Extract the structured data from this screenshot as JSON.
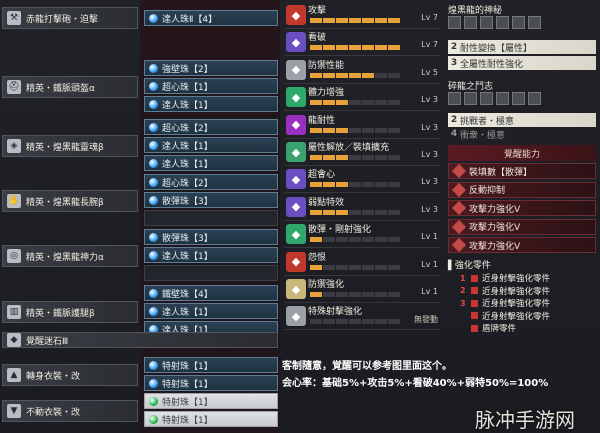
{
  "equipment": [
    {
      "name": "赤龍打擊砲・迫擊",
      "icon": "weapon-icon",
      "decos": [
        "達人珠Ⅱ【4】"
      ]
    },
    {
      "name": "精英・鐵脈頭盔α",
      "icon": "helmet-icon",
      "decos": [
        "強壁珠【2】",
        "超心珠【1】",
        "達人珠【1】"
      ]
    },
    {
      "name": "精英・煌黑龍靈魂β",
      "icon": "chest-icon",
      "decos": [
        "超心珠【2】",
        "達人珠【1】",
        "達人珠【1】"
      ]
    },
    {
      "name": "精英・煌黑龍長腕β",
      "icon": "arm-icon",
      "decos": [
        "超心珠【2】",
        "散彈珠【3】",
        ""
      ]
    },
    {
      "name": "精英・煌黑龍神力α",
      "icon": "waist-icon",
      "decos": [
        "散彈珠【3】",
        "達人珠【1】",
        ""
      ]
    },
    {
      "name": "精英・鐵脈護腿β",
      "icon": "leg-icon",
      "decos": [
        "鐵壁珠【4】",
        "達人珠【1】",
        "達人珠【1】"
      ]
    },
    {
      "name": "覺醒迷石Ⅲ",
      "icon": "charm-icon",
      "decos": []
    },
    {
      "name": "轉身衣裝・改",
      "icon": "mantle-icon",
      "decos": [
        "特射珠【1】",
        "特射珠【1】"
      ]
    },
    {
      "name": "不動衣裝・改",
      "icon": "mantle2-icon",
      "decos": [
        "特射珠【1】",
        "特射珠【1】"
      ]
    }
  ],
  "skills": [
    {
      "name": "攻擊",
      "lv": "Lv 7",
      "color": "#c0392b",
      "icon": "attack-icon",
      "fill": 7
    },
    {
      "name": "看破",
      "lv": "Lv 7",
      "color": "#6b4fc2",
      "icon": "eye-icon",
      "fill": 7
    },
    {
      "name": "防禦性能",
      "lv": "Lv 5",
      "color": "#9aa0a6",
      "icon": "guard-icon",
      "fill": 5
    },
    {
      "name": "體力增強",
      "lv": "Lv 3",
      "color": "#2fa86b",
      "icon": "health-icon",
      "fill": 3
    },
    {
      "name": "龍耐性",
      "lv": "Lv 3",
      "color": "#9b2fc2",
      "icon": "dragon-icon",
      "fill": 3
    },
    {
      "name": "屬性解放／裝填擴充",
      "lv": "Lv 3",
      "color": "#3aa36e",
      "icon": "unlock-icon",
      "fill": 3
    },
    {
      "name": "超會心",
      "lv": "Lv 3",
      "color": "#6b4fc2",
      "icon": "crit-icon",
      "fill": 3
    },
    {
      "name": "弱點特效",
      "lv": "Lv 3",
      "color": "#6b4fc2",
      "icon": "weakness-icon",
      "fill": 3
    },
    {
      "name": "散彈・剛射強化",
      "lv": "Lv 1",
      "color": "#2fa86b",
      "icon": "spread-icon",
      "fill": 1
    },
    {
      "name": "怨恨",
      "lv": "Lv 1",
      "color": "#c0392b",
      "icon": "resent-icon",
      "fill": 1
    },
    {
      "name": "防禦強化",
      "lv": "Lv 1",
      "color": "#c9b77a",
      "icon": "shield-icon",
      "fill": 1
    },
    {
      "name": "特殊射擊強化",
      "lv": "無發動",
      "color": "#9aa0a6",
      "icon": "special-icon",
      "fill": 0
    }
  ],
  "set_bonus_1": {
    "title": "煌黑龍的神秘",
    "items": [
      {
        "num": "2",
        "label": "耐性變換【屬性】"
      },
      {
        "num": "3",
        "label": "全屬性耐性強化"
      }
    ]
  },
  "set_bonus_2": {
    "title": "碎龍之鬥志",
    "items": [
      {
        "num": "2",
        "label": "挑戰者・極意"
      },
      {
        "num": "4",
        "label": "衝衆・極意"
      }
    ]
  },
  "awaken": {
    "title": "覺醒能力",
    "rows": [
      "裝填數【散彈】",
      "反動抑制",
      "攻擊力強化Ⅴ",
      "攻擊力強化Ⅴ",
      "攻擊力強化Ⅴ"
    ]
  },
  "augments": {
    "title": "強化零件",
    "items": [
      {
        "num": "1",
        "label": "近身射擊強化零件"
      },
      {
        "num": "2",
        "label": "近身射擊強化零件"
      },
      {
        "num": "3",
        "label": "近身射擊強化零件"
      },
      {
        "num": "",
        "label": "近身射擊強化零件"
      },
      {
        "num": "",
        "label": "盾牌零件"
      }
    ]
  },
  "notes": {
    "line1": "客制隨意，覚醒可以参考图里面这个。",
    "line2": "会心率：基础5%+攻击5%+看破40%+弱特50%=100%"
  },
  "watermark": "脉冲手游网"
}
